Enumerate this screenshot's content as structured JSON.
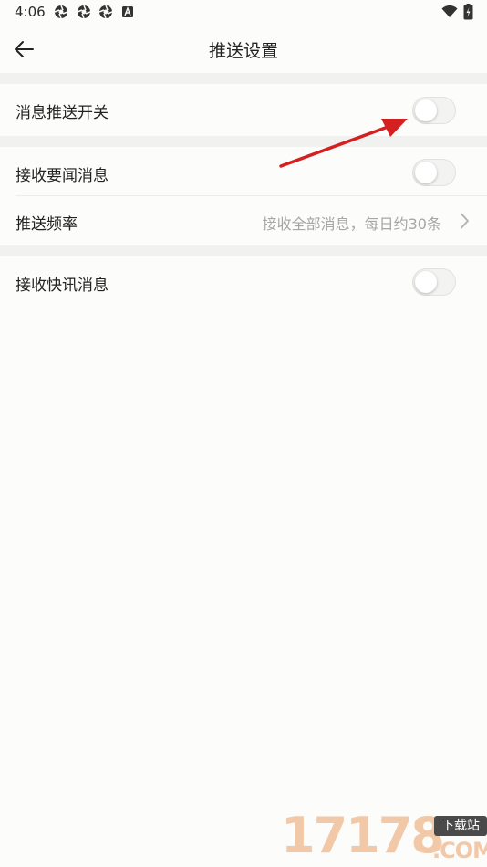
{
  "status_bar": {
    "time": "4:06",
    "left_icons": [
      "aperture-icon",
      "aperture-icon",
      "aperture-icon",
      "a-badge-icon"
    ],
    "right_icons": [
      "wifi-icon",
      "battery-icon"
    ]
  },
  "header": {
    "title": "推送设置",
    "back_icon": "arrow-left-icon"
  },
  "settings": {
    "push_switch": {
      "label": "消息推送开关",
      "on": false
    },
    "important_news": {
      "label": "接收要闻消息",
      "on": false
    },
    "frequency": {
      "label": "推送频率",
      "value": "接收全部消息，每日约30条",
      "icon": "chevron-right-icon"
    },
    "flash_news": {
      "label": "接收快讯消息",
      "on": false
    }
  },
  "annotation": {
    "type": "red-arrow",
    "color": "#d42020"
  },
  "watermark": {
    "digits": "17178",
    "badge": "下载站",
    "suffix": ".COM"
  },
  "colors": {
    "background": "#fcfcfb",
    "section_gap": "#f1f1ef",
    "text_primary": "#222222",
    "text_secondary": "#a6a6a6"
  }
}
